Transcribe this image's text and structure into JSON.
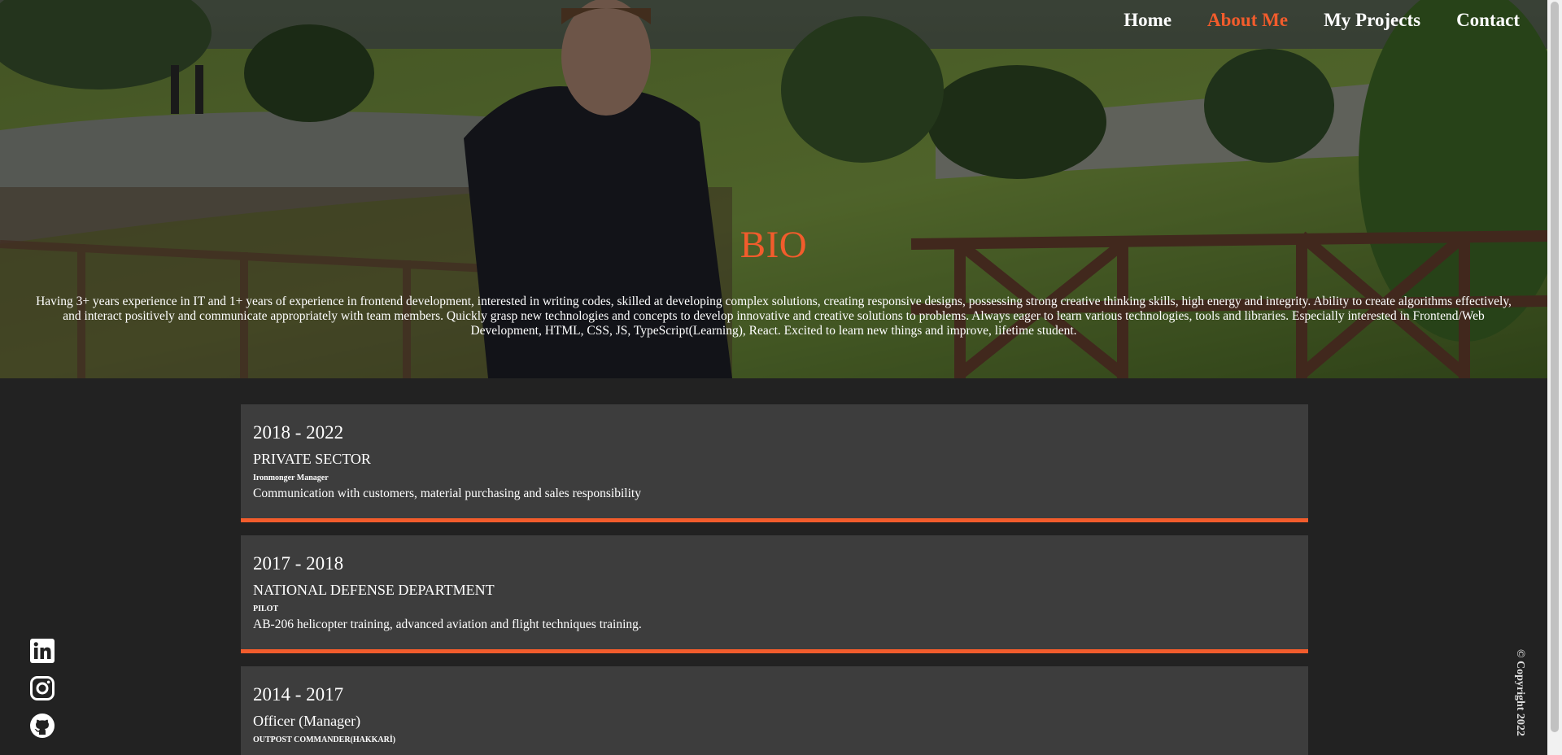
{
  "nav": {
    "items": [
      {
        "label": "Home",
        "active": false
      },
      {
        "label": "About Me",
        "active": true
      },
      {
        "label": "My Projects",
        "active": false
      },
      {
        "label": "Contact",
        "active": false
      }
    ]
  },
  "hero": {
    "title": "BIO",
    "text": "Having 3+ years experience in IT and 1+ years of experience in frontend development, interested in writing codes, skilled at developing complex solutions, creating responsive designs, possessing strong creative thinking skills, high energy and integrity. Ability to create algorithms effectively, and interact positively and communicate appropriately with team members. Quickly grasp new technologies and concepts to develop innovative and creative solutions to problems. Always eager to learn various technologies, tools and libraries. Especially interested in Frontend/Web Development, HTML, CSS, JS, TypeScript(Learning), React. Excited to learn new things and improve, lifetime student."
  },
  "timeline": [
    {
      "years": "2018 - 2022",
      "organization": "PRIVATE SECTOR",
      "role": "Ironmonger Manager",
      "description": "Communication with customers, material purchasing and sales responsibility"
    },
    {
      "years": "2017 - 2018",
      "organization": "NATIONAL DEFENSE DEPARTMENT",
      "role": "PILOT",
      "description": "AB-206 helicopter training, advanced aviation and flight techniques training."
    },
    {
      "years": "2014 - 2017",
      "organization": "Officer (Manager)",
      "role": "OUTPOST COMMANDER(HAKKARİ)",
      "description": ""
    }
  ],
  "social": [
    "linkedin-icon",
    "instagram-icon",
    "github-icon"
  ],
  "copyright": "© Copyright 2022",
  "colors": {
    "accent": "#f25c2c",
    "background": "#222222",
    "card": "#3d3d3d"
  }
}
